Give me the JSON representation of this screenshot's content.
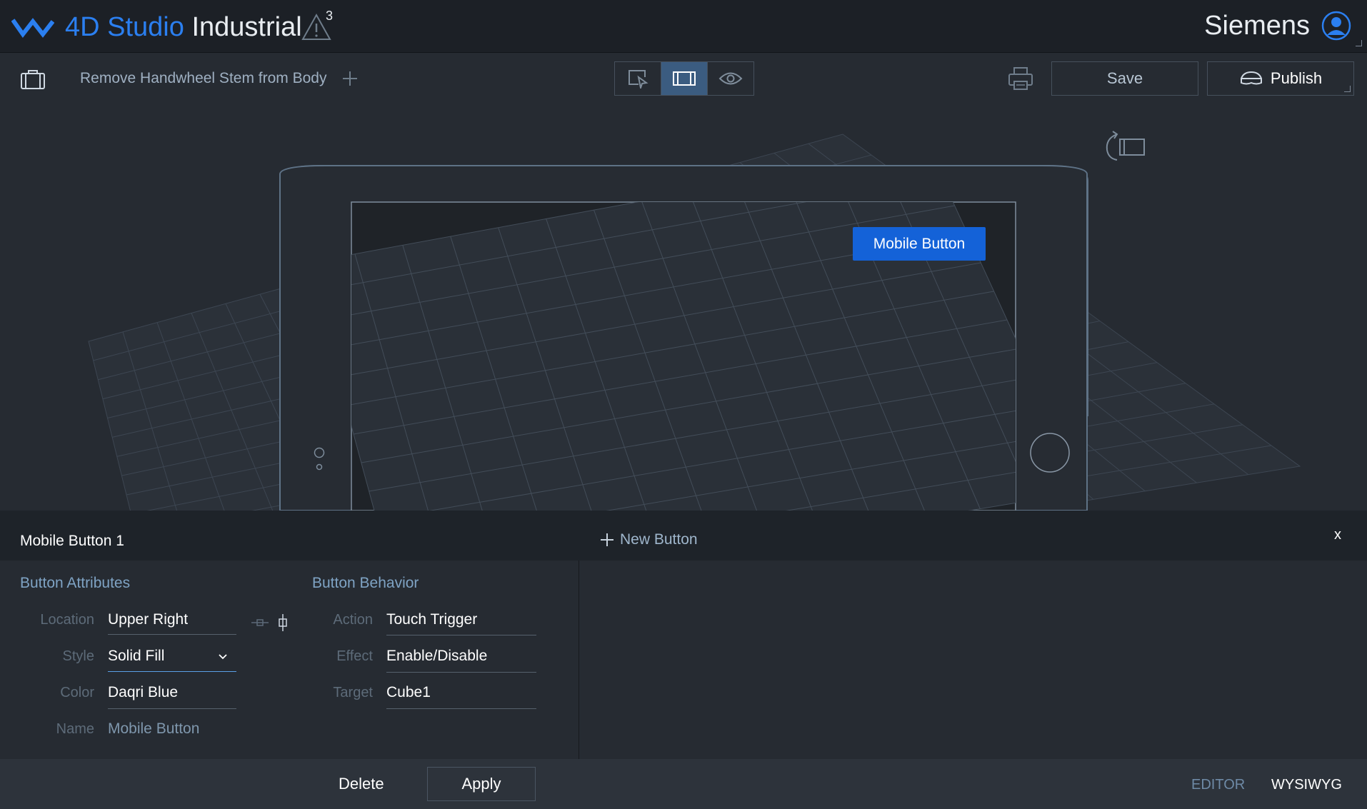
{
  "header": {
    "brand": "4D Studio",
    "product": "Industrial",
    "alert_count": "3",
    "organization": "Siemens",
    "icons": [
      "daqri-logo-icon",
      "warning-icon",
      "user-avatar-icon"
    ]
  },
  "toolbar": {
    "scene_name": "Remove Handwheel Stem from Body",
    "modes": [
      "select-mode-icon",
      "film-mode-icon",
      "preview-eye-icon"
    ],
    "active_mode": "film-mode-icon",
    "save_label": "Save",
    "publish_label": "Publish"
  },
  "viewport": {
    "mobile_button_label": "Mobile Button",
    "accent_color": "#1462d8"
  },
  "panel": {
    "title": "Mobile Button 1",
    "new_button_label": "New Button",
    "close_label": "x",
    "attributes": {
      "title": "Button Attributes",
      "location_label": "Location",
      "location_value": "Upper Right",
      "style_label": "Style",
      "style_value": "Solid Fill",
      "color_label": "Color",
      "color_value": "Daqri Blue",
      "name_label": "Name",
      "name_value": "Mobile Button"
    },
    "behavior": {
      "title": "Button Behavior",
      "action_label": "Action",
      "action_value": "Touch Trigger",
      "effect_label": "Effect",
      "effect_value": "Enable/Disable",
      "target_label": "Target",
      "target_value": "Cube1"
    }
  },
  "footer": {
    "delete_label": "Delete",
    "apply_label": "Apply",
    "editor_tab": "EDITOR",
    "wysiwyg_tab": "WYSIWYG",
    "active_tab": "WYSIWYG"
  }
}
